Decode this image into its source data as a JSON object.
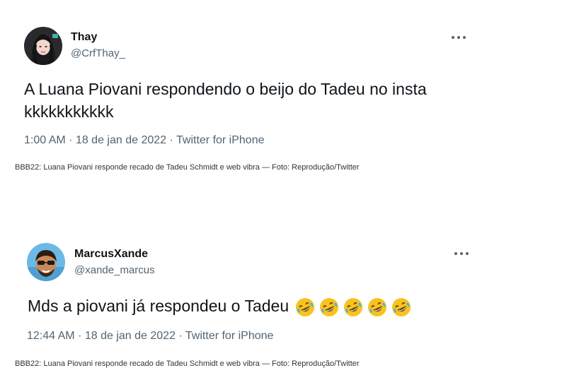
{
  "tweets": [
    {
      "name": "Thay",
      "handle": "@CrfThay_",
      "text": "A Luana Piovani respondendo o beijo do Tadeu no insta kkkkkkkkkkk",
      "time": "1:00 AM",
      "date": "18 de jan de 2022",
      "source": "Twitter for iPhone"
    },
    {
      "name": "MarcusXande",
      "handle": "@xande_marcus",
      "text": "Mds a piovani já respondeu o Tadeu",
      "emoji_count": 5,
      "emoji_icon": "rolling-on-floor-laughing-icon",
      "time": "12:44 AM",
      "date": "18 de jan de 2022",
      "source": "Twitter for iPhone"
    }
  ],
  "separator": "·",
  "captions": [
    "BBB22: Luana Piovani responde recado de Tadeu Schmidt e web vibra — Foto: Reprodução/Twitter",
    "BBB22: Luana Piovani responde recado de Tadeu Schmidt e web vibra — Foto: Reprodução/Twitter"
  ],
  "colors": {
    "text": "#0f1419",
    "secondary": "#536471",
    "emoji": "#f7c31e"
  }
}
